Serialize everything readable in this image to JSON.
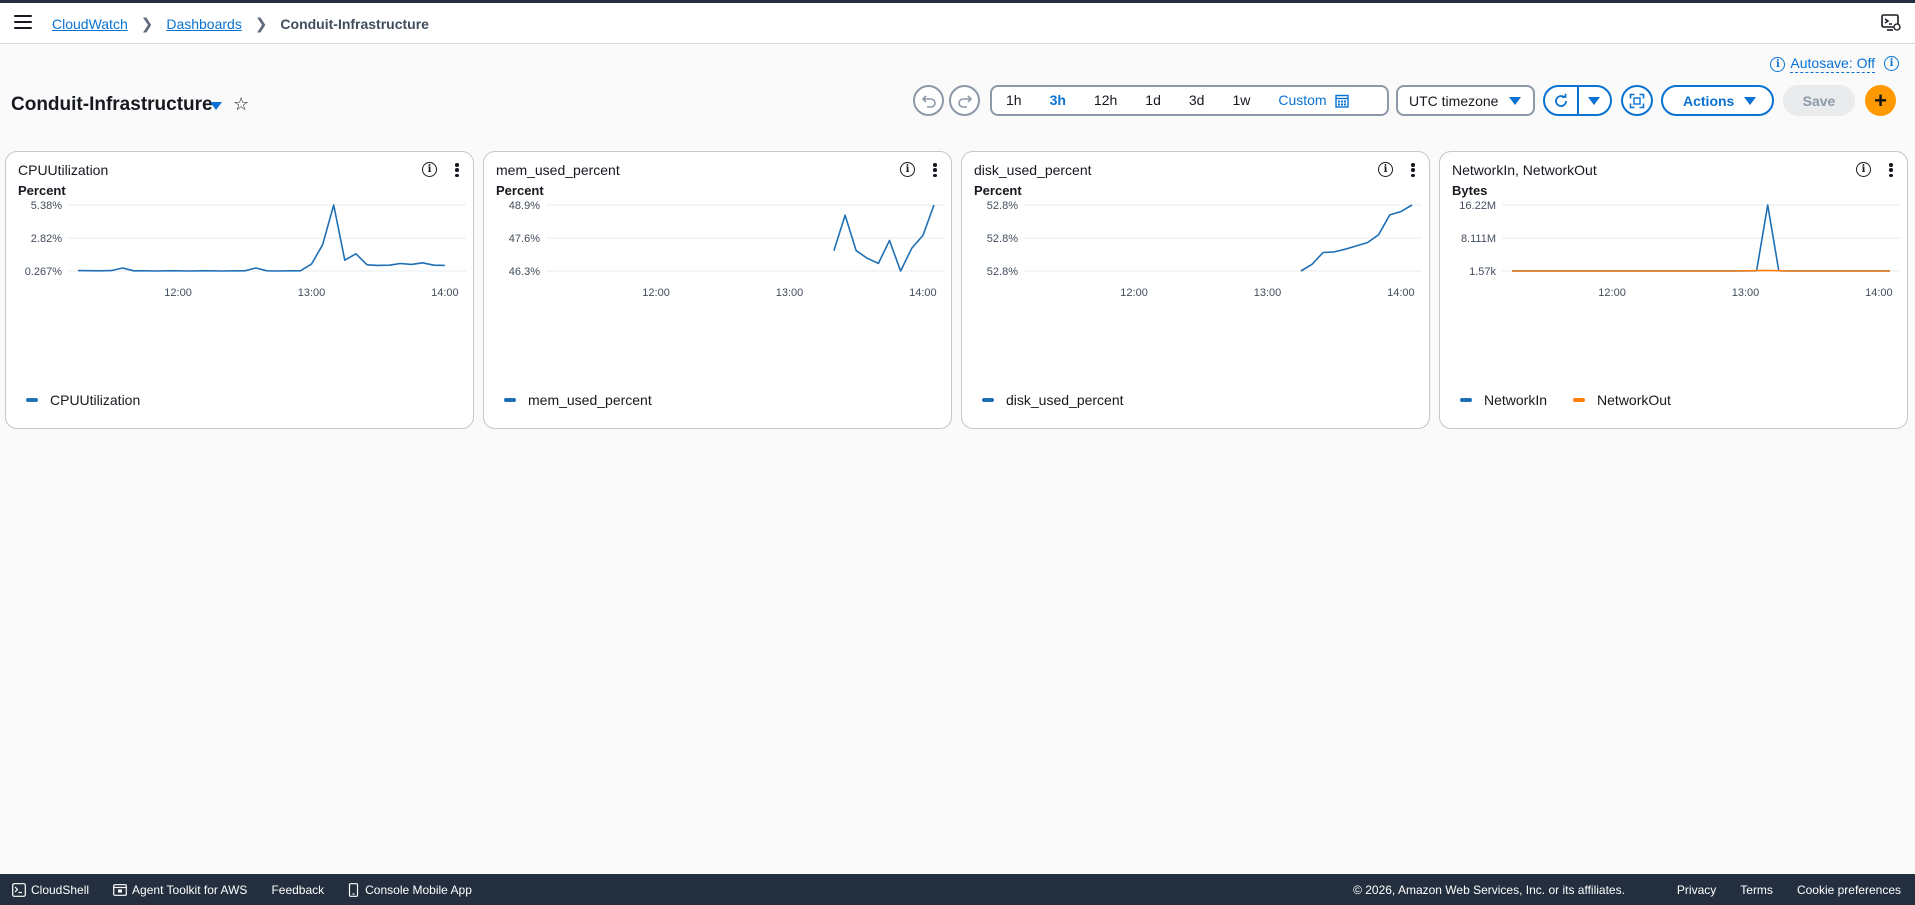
{
  "breadcrumbs": [
    {
      "label": "CloudWatch"
    },
    {
      "label": "Dashboards"
    },
    {
      "label": "Conduit-Infrastructure"
    }
  ],
  "header": {
    "autosave_label": "Autosave: Off",
    "dashboard_title": "Conduit-Infrastructure"
  },
  "toolbar": {
    "time_ranges": [
      "1h",
      "3h",
      "12h",
      "1d",
      "3d",
      "1w"
    ],
    "active_time_range": "3h",
    "custom_label": "Custom",
    "timezone": "UTC timezone",
    "actions_label": "Actions",
    "save_label": "Save",
    "add_label": "+"
  },
  "colors": {
    "accent": "#0972d3",
    "series_blue": "#1f6fb5",
    "series_orange": "#ff7f0e",
    "add_button": "#ff9900",
    "footer_bg": "#232f3e"
  },
  "widgets": [
    {
      "title": "CPUUtilization",
      "unit": "Percent",
      "legend": [
        "CPUUtilization"
      ]
    },
    {
      "title": "mem_used_percent",
      "unit": "Percent",
      "legend": [
        "mem_used_percent"
      ]
    },
    {
      "title": "disk_used_percent",
      "unit": "Percent",
      "legend": [
        "disk_used_percent"
      ]
    },
    {
      "title": "NetworkIn, NetworkOut",
      "unit": "Bytes",
      "legend": [
        "NetworkIn",
        "NetworkOut"
      ]
    }
  ],
  "chart_data": [
    {
      "type": "line",
      "ylabel": "Percent",
      "y_ticks": [
        "5.38%",
        "2.82%",
        "0.267%"
      ],
      "ylim": [
        0.267,
        5.38
      ],
      "x_ticks": [
        "12:00",
        "13:00",
        "14:00"
      ],
      "x_tick_minutes": [
        720,
        780,
        840
      ],
      "xlim_minutes": [
        675,
        845
      ],
      "series": [
        {
          "name": "CPUUtilization",
          "color": "#1f6fb5",
          "x": [
            675,
            680,
            685,
            690,
            695,
            700,
            705,
            710,
            715,
            720,
            725,
            730,
            735,
            740,
            745,
            750,
            755,
            760,
            765,
            770,
            775,
            780,
            785,
            790,
            795,
            800,
            805,
            810,
            815,
            820,
            825,
            830,
            835,
            840
          ],
          "y": [
            0.3,
            0.29,
            0.28,
            0.3,
            0.5,
            0.28,
            0.28,
            0.27,
            0.28,
            0.28,
            0.27,
            0.28,
            0.28,
            0.27,
            0.28,
            0.28,
            0.5,
            0.28,
            0.27,
            0.28,
            0.28,
            0.8,
            2.3,
            5.38,
            1.1,
            1.6,
            0.75,
            0.7,
            0.72,
            0.85,
            0.78,
            0.9,
            0.72,
            0.7
          ]
        }
      ]
    },
    {
      "type": "line",
      "ylabel": "Percent",
      "y_ticks": [
        "48.9%",
        "47.6%",
        "46.3%"
      ],
      "ylim": [
        46.3,
        48.9
      ],
      "x_ticks": [
        "12:00",
        "13:00",
        "14:00"
      ],
      "x_tick_minutes": [
        720,
        780,
        840
      ],
      "xlim_minutes": [
        675,
        845
      ],
      "series": [
        {
          "name": "mem_used_percent",
          "color": "#1f6fb5",
          "x": [
            800,
            805,
            810,
            815,
            820,
            825,
            830,
            835,
            840,
            845
          ],
          "y": [
            47.1,
            48.5,
            47.1,
            46.8,
            46.6,
            47.5,
            46.3,
            47.2,
            47.7,
            48.9
          ]
        }
      ]
    },
    {
      "type": "line",
      "ylabel": "Percent",
      "y_ticks": [
        "52.8%",
        "52.8%",
        "52.8%"
      ],
      "ylim": [
        0,
        100
      ],
      "x_ticks": [
        "12:00",
        "13:00",
        "14:00"
      ],
      "x_tick_minutes": [
        720,
        780,
        840
      ],
      "xlim_minutes": [
        675,
        845
      ],
      "series": [
        {
          "name": "disk_used_percent",
          "color": "#1f6fb5",
          "x": [
            795,
            800,
            805,
            810,
            815,
            820,
            825,
            830,
            835,
            840,
            845
          ],
          "y": [
            0,
            10,
            28,
            29,
            33,
            38,
            43,
            55,
            85,
            90,
            100
          ]
        }
      ]
    },
    {
      "type": "line",
      "ylabel": "Bytes",
      "y_ticks": [
        "16.22M",
        "8.111M",
        "1.57k"
      ],
      "ylim": [
        0.00157,
        16.22
      ],
      "x_ticks": [
        "12:00",
        "13:00",
        "14:00"
      ],
      "x_tick_minutes": [
        720,
        780,
        840
      ],
      "xlim_minutes": [
        675,
        845
      ],
      "series": [
        {
          "name": "NetworkIn",
          "color": "#1f6fb5",
          "x": [
            675,
            700,
            725,
            750,
            775,
            785,
            790,
            795,
            800,
            825,
            845
          ],
          "y": [
            0.02,
            0.02,
            0.02,
            0.02,
            0.02,
            0.05,
            16.22,
            0.05,
            0.02,
            0.02,
            0.02
          ]
        },
        {
          "name": "NetworkOut",
          "color": "#ff7f0e",
          "x": [
            675,
            700,
            725,
            750,
            775,
            790,
            800,
            825,
            845
          ],
          "y": [
            0.01,
            0.01,
            0.01,
            0.01,
            0.01,
            0.15,
            0.01,
            0.01,
            0.01
          ]
        }
      ]
    }
  ],
  "footer": {
    "cloudshell": "CloudShell",
    "agent_toolkit": "Agent Toolkit for AWS",
    "feedback": "Feedback",
    "mobile_app": "Console Mobile App",
    "copyright": "© 2026, Amazon Web Services, Inc. or its affiliates.",
    "privacy": "Privacy",
    "terms": "Terms",
    "cookies": "Cookie preferences"
  }
}
